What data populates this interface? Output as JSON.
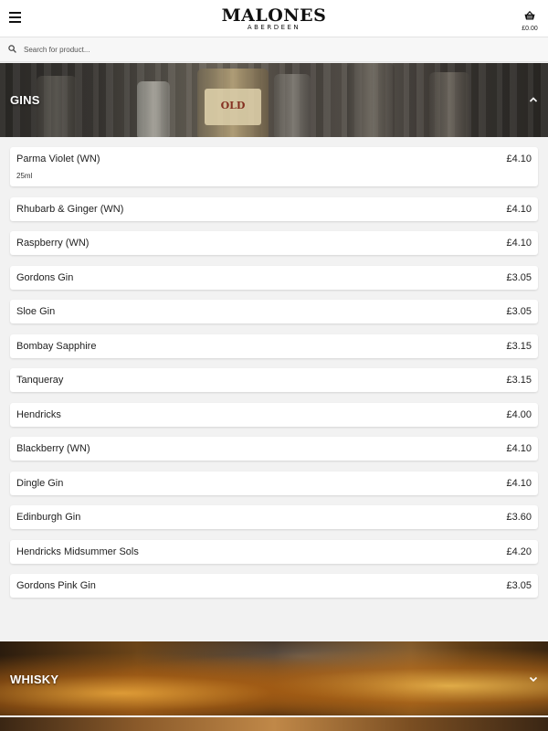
{
  "header": {
    "logo_main": "MALONES",
    "logo_sub": "ABERDEEN",
    "basket_total": "£0.00",
    "icons": {
      "menu": "hamburger-menu-icon",
      "basket": "basket-icon"
    }
  },
  "search": {
    "placeholder": "Search for product...",
    "icon": "search-icon"
  },
  "sections": {
    "gins": {
      "title": "GINS",
      "expanded": true,
      "banner_bottle_label": "OLD",
      "items": [
        {
          "name": "Parma Violet (WN)",
          "note": "25ml",
          "price": "£4.10"
        },
        {
          "name": "Rhubarb & Ginger (WN)",
          "price": "£4.10"
        },
        {
          "name": "Raspberry (WN)",
          "price": "£4.10"
        },
        {
          "name": "Gordons Gin",
          "price": "£3.05"
        },
        {
          "name": "Sloe Gin",
          "price": "£3.05"
        },
        {
          "name": "Bombay Sapphire",
          "price": "£3.15"
        },
        {
          "name": "Tanqueray",
          "price": "£3.15"
        },
        {
          "name": "Hendricks",
          "price": "£4.00"
        },
        {
          "name": "Blackberry (WN)",
          "price": "£4.10"
        },
        {
          "name": "Dingle Gin",
          "price": "£4.10"
        },
        {
          "name": "Edinburgh Gin",
          "price": "£3.60"
        },
        {
          "name": "Hendricks Midsummer Sols",
          "price": "£4.20"
        },
        {
          "name": "Gordons Pink Gin",
          "price": "£3.05"
        }
      ]
    },
    "whisky": {
      "title": "WHISKY",
      "expanded": false
    }
  },
  "colors": {
    "background": "#f2f2f2",
    "card": "#ffffff",
    "banner_text": "#ffffff"
  }
}
